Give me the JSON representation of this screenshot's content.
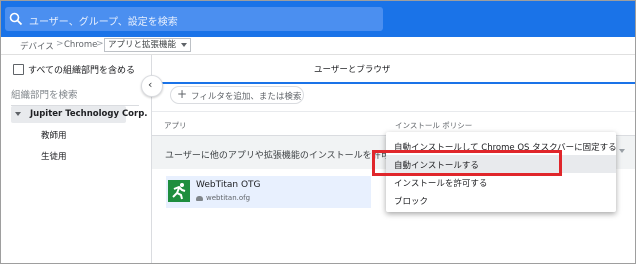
{
  "search": {
    "placeholder": "ユーザー、グループ、設定を検索"
  },
  "breadcrumb": {
    "item1": "デバイス",
    "item2": "Chrome",
    "current": "アプリと拡張機能"
  },
  "left_panel": {
    "include_all_label": "すべての組織部門を含める",
    "search_placeholder": "組織部門を検索",
    "root_org": "Jupiter Technology Corp.",
    "children": [
      "教師用",
      "生徒用"
    ]
  },
  "main": {
    "tab_label": "ユーザーとブラウザ",
    "filter_label": "フィルタを追加、または検索",
    "columns": {
      "app": "アプリ",
      "policy": "インストール ポリシー"
    },
    "allow_text": "ユーザーに他のアプリや拡張機能のインストールを許可す",
    "app": {
      "name": "WebTitan OTG",
      "id": "webtitan.ofg"
    }
  },
  "menu": {
    "items": [
      "自動インストールして Chrome OS タスクバーに固定する",
      "自動インストールする",
      "インストールを許可する",
      "ブロック"
    ]
  },
  "colors": {
    "accent": "#1a73e8",
    "highlight": "#e0262b",
    "app_icon": "#1e8e3e"
  }
}
